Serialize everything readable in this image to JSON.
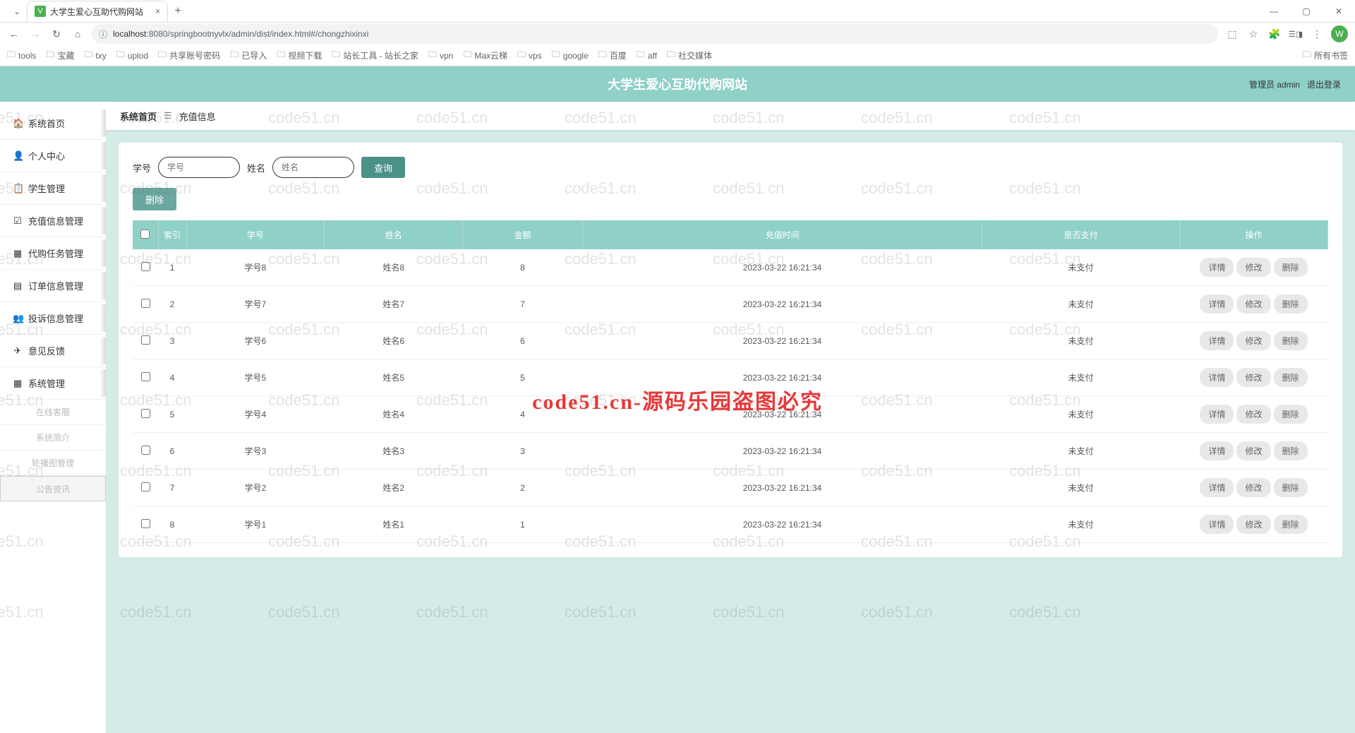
{
  "browser": {
    "tab_title": "大学生爱心互助代购网站",
    "url_host": "localhost",
    "url_port": ":8080",
    "url_path": "/springbootnyvlx/admin/dist/index.html#/chongzhixinxi",
    "avatar_initial": "W",
    "bookmarks": [
      "tools",
      "宝藏",
      "txy",
      "uplod",
      "共享账号密码",
      "已导入",
      "视频下载",
      "站长工具 - 站长之家",
      "vpn",
      "Max云梯",
      "vps",
      "google",
      "百度",
      "aff",
      "社交媒体"
    ],
    "all_bookmarks": "所有书签"
  },
  "app": {
    "title": "大学生爱心互助代购网站",
    "header_user": "管理员 admin",
    "header_logout": "退出登录"
  },
  "sidebar": {
    "items": [
      {
        "icon": "🏠",
        "label": "系统首页"
      },
      {
        "icon": "👤",
        "label": "个人中心"
      },
      {
        "icon": "📋",
        "label": "学生管理"
      },
      {
        "icon": "☑",
        "label": "充值信息管理"
      },
      {
        "icon": "▦",
        "label": "代购任务管理"
      },
      {
        "icon": "▤",
        "label": "订单信息管理"
      },
      {
        "icon": "👥",
        "label": "投诉信息管理"
      },
      {
        "icon": "✈",
        "label": "意见反馈"
      },
      {
        "icon": "▦",
        "label": "系统管理"
      }
    ],
    "subs": [
      "在线客服",
      "系统简介",
      "轮播图管理",
      "公告资讯"
    ]
  },
  "breadcrumb": {
    "home": "系统首页",
    "current": "充值信息"
  },
  "search": {
    "label1": "学号",
    "placeholder1": "学号",
    "label2": "姓名",
    "placeholder2": "姓名",
    "query_btn": "查询",
    "delete_btn": "删除"
  },
  "table": {
    "headers": [
      "索引",
      "学号",
      "姓名",
      "金额",
      "充值时间",
      "是否支付",
      "操作"
    ],
    "action_labels": {
      "detail": "详情",
      "edit": "修改",
      "delete": "删除"
    },
    "rows": [
      {
        "idx": "1",
        "sno": "学号8",
        "name": "姓名8",
        "amount": "8",
        "time": "2023-03-22 16:21:34",
        "paid": "未支付"
      },
      {
        "idx": "2",
        "sno": "学号7",
        "name": "姓名7",
        "amount": "7",
        "time": "2023-03-22 16:21:34",
        "paid": "未支付"
      },
      {
        "idx": "3",
        "sno": "学号6",
        "name": "姓名6",
        "amount": "6",
        "time": "2023-03-22 16:21:34",
        "paid": "未支付"
      },
      {
        "idx": "4",
        "sno": "学号5",
        "name": "姓名5",
        "amount": "5",
        "time": "2023-03-22 16:21:34",
        "paid": "未支付"
      },
      {
        "idx": "5",
        "sno": "学号4",
        "name": "姓名4",
        "amount": "4",
        "time": "2023-03-22 16:21:34",
        "paid": "未支付"
      },
      {
        "idx": "6",
        "sno": "学号3",
        "name": "姓名3",
        "amount": "3",
        "time": "2023-03-22 16:21:34",
        "paid": "未支付"
      },
      {
        "idx": "7",
        "sno": "学号2",
        "name": "姓名2",
        "amount": "2",
        "time": "2023-03-22 16:21:34",
        "paid": "未支付"
      },
      {
        "idx": "8",
        "sno": "学号1",
        "name": "姓名1",
        "amount": "1",
        "time": "2023-03-22 16:21:34",
        "paid": "未支付"
      }
    ]
  },
  "watermark_text": "code51.cn",
  "watermark_main": "code51.cn-源码乐园盗图必究"
}
